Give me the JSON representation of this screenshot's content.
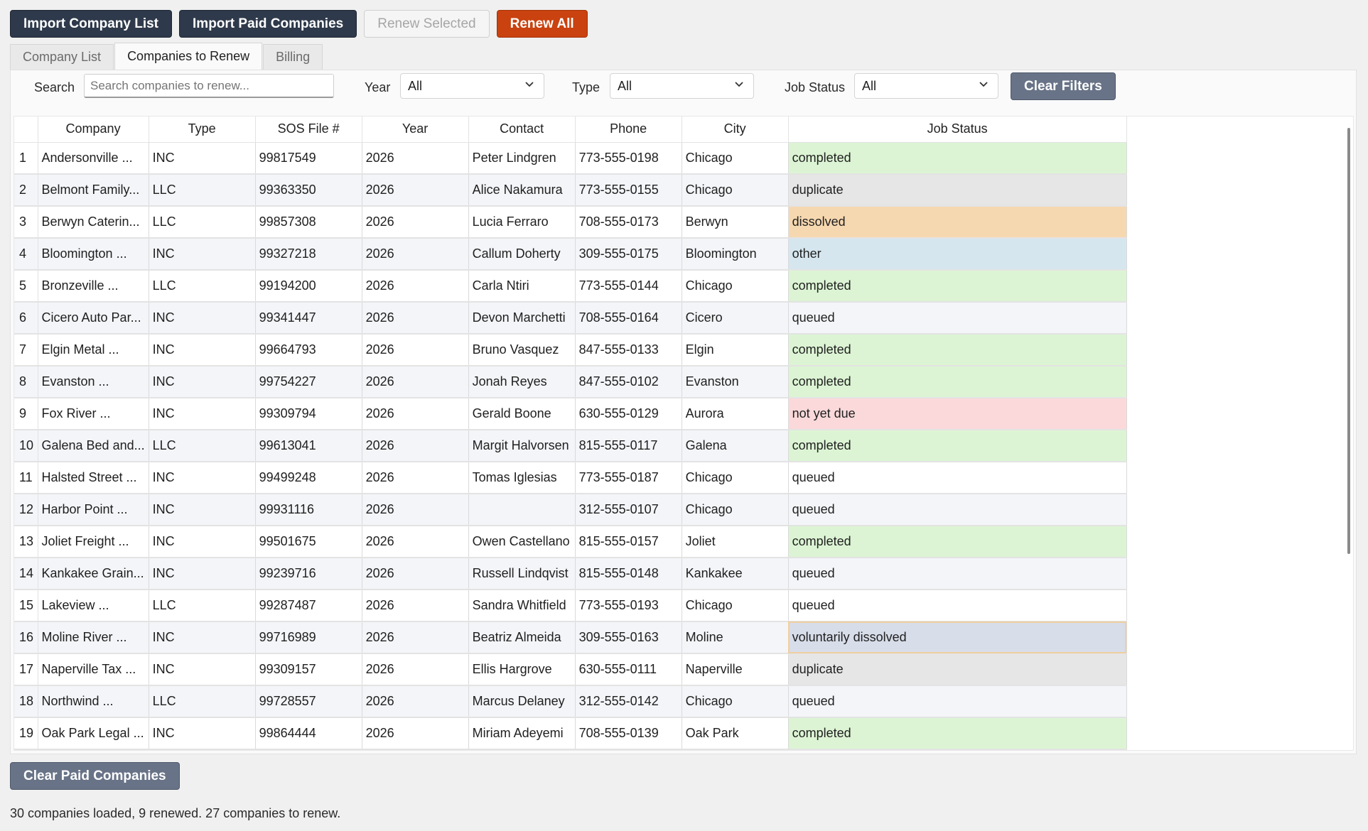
{
  "toolbar": {
    "import_company_list": "Import Company List",
    "import_paid": "Import Paid Companies",
    "renew_selected": "Renew Selected",
    "renew_all": "Renew All"
  },
  "tabs": [
    {
      "label": "Company List",
      "active": false
    },
    {
      "label": "Companies to Renew",
      "active": true
    },
    {
      "label": "Billing",
      "active": false
    }
  ],
  "filters": {
    "search_label": "Search",
    "search_placeholder": "Search companies to renew...",
    "year_label": "Year",
    "year_value": "All",
    "type_label": "Type",
    "type_value": "All",
    "job_status_label": "Job Status",
    "job_status_value": "All",
    "clear_filters": "Clear Filters"
  },
  "columns": [
    "Company",
    "Type",
    "SOS File #",
    "Year",
    "Contact",
    "Phone",
    "City",
    "Job Status"
  ],
  "rows": [
    {
      "n": "1",
      "company": "Andersonville ...",
      "type": "INC",
      "sos": "99817549",
      "year": "2026",
      "contact": "Peter Lindgren",
      "phone": "773-555-0198",
      "city": "Chicago",
      "status": "completed"
    },
    {
      "n": "2",
      "company": "Belmont Family...",
      "type": "LLC",
      "sos": "99363350",
      "year": "2026",
      "contact": "Alice Nakamura",
      "phone": "773-555-0155",
      "city": "Chicago",
      "status": "duplicate"
    },
    {
      "n": "3",
      "company": "Berwyn Caterin...",
      "type": "LLC",
      "sos": "99857308",
      "year": "2026",
      "contact": "Lucia Ferraro",
      "phone": "708-555-0173",
      "city": "Berwyn",
      "status": "dissolved"
    },
    {
      "n": "4",
      "company": "Bloomington ...",
      "type": "INC",
      "sos": "99327218",
      "year": "2026",
      "contact": "Callum Doherty",
      "phone": "309-555-0175",
      "city": "Bloomington",
      "status": "other"
    },
    {
      "n": "5",
      "company": "Bronzeville ...",
      "type": "LLC",
      "sos": "99194200",
      "year": "2026",
      "contact": "Carla Ntiri",
      "phone": "773-555-0144",
      "city": "Chicago",
      "status": "completed"
    },
    {
      "n": "6",
      "company": "Cicero Auto Par...",
      "type": "INC",
      "sos": "99341447",
      "year": "2026",
      "contact": "Devon Marchetti",
      "phone": "708-555-0164",
      "city": "Cicero",
      "status": "queued"
    },
    {
      "n": "7",
      "company": "Elgin Metal ...",
      "type": "INC",
      "sos": "99664793",
      "year": "2026",
      "contact": "Bruno Vasquez",
      "phone": "847-555-0133",
      "city": "Elgin",
      "status": "completed"
    },
    {
      "n": "8",
      "company": "Evanston ...",
      "type": "INC",
      "sos": "99754227",
      "year": "2026",
      "contact": "Jonah Reyes",
      "phone": "847-555-0102",
      "city": "Evanston",
      "status": "completed"
    },
    {
      "n": "9",
      "company": "Fox River ...",
      "type": "INC",
      "sos": "99309794",
      "year": "2026",
      "contact": "Gerald Boone",
      "phone": "630-555-0129",
      "city": "Aurora",
      "status": "not yet due"
    },
    {
      "n": "10",
      "company": "Galena Bed and...",
      "type": "LLC",
      "sos": "99613041",
      "year": "2026",
      "contact": "Margit Halvorsen",
      "phone": "815-555-0117",
      "city": "Galena",
      "status": "completed"
    },
    {
      "n": "11",
      "company": "Halsted Street ...",
      "type": "INC",
      "sos": "99499248",
      "year": "2026",
      "contact": "Tomas Iglesias",
      "phone": "773-555-0187",
      "city": "Chicago",
      "status": "queued"
    },
    {
      "n": "12",
      "company": "Harbor Point ...",
      "type": "INC",
      "sos": "99931116",
      "year": "2026",
      "contact": "",
      "phone": "312-555-0107",
      "city": "Chicago",
      "status": "queued"
    },
    {
      "n": "13",
      "company": "Joliet Freight ...",
      "type": "INC",
      "sos": "99501675",
      "year": "2026",
      "contact": "Owen Castellano",
      "phone": "815-555-0157",
      "city": "Joliet",
      "status": "completed"
    },
    {
      "n": "14",
      "company": "Kankakee Grain...",
      "type": "INC",
      "sos": "99239716",
      "year": "2026",
      "contact": "Russell Lindqvist",
      "phone": "815-555-0148",
      "city": "Kankakee",
      "status": "queued"
    },
    {
      "n": "15",
      "company": "Lakeview ...",
      "type": "LLC",
      "sos": "99287487",
      "year": "2026",
      "contact": "Sandra Whitfield",
      "phone": "773-555-0193",
      "city": "Chicago",
      "status": "queued"
    },
    {
      "n": "16",
      "company": "Moline River ...",
      "type": "INC",
      "sos": "99716989",
      "year": "2026",
      "contact": "Beatriz Almeida",
      "phone": "309-555-0163",
      "city": "Moline",
      "status": "voluntarily dissolved"
    },
    {
      "n": "17",
      "company": "Naperville Tax ...",
      "type": "INC",
      "sos": "99309157",
      "year": "2026",
      "contact": "Ellis Hargrove",
      "phone": "630-555-0111",
      "city": "Naperville",
      "status": "duplicate"
    },
    {
      "n": "18",
      "company": "Northwind ...",
      "type": "LLC",
      "sos": "99728557",
      "year": "2026",
      "contact": "Marcus Delaney",
      "phone": "312-555-0142",
      "city": "Chicago",
      "status": "queued"
    },
    {
      "n": "19",
      "company": "Oak Park Legal ...",
      "type": "INC",
      "sos": "99864444",
      "year": "2026",
      "contact": "Miriam Adeyemi",
      "phone": "708-555-0139",
      "city": "Oak Park",
      "status": "completed"
    }
  ],
  "status_colors": {
    "completed": "#dcf4d4",
    "duplicate": "#e6e6e6",
    "dissolved": "#f6d8b0",
    "other": "#d5e6ef",
    "not yet due": "#fbd9da",
    "voluntarily dissolved": "#d7dde9",
    "queued": ""
  },
  "footer": {
    "clear_paid": "Clear Paid Companies",
    "status_text": "30 companies loaded, 9 renewed. 27 companies to renew."
  },
  "icons": {
    "dropdown": "chevron-down-icon"
  }
}
